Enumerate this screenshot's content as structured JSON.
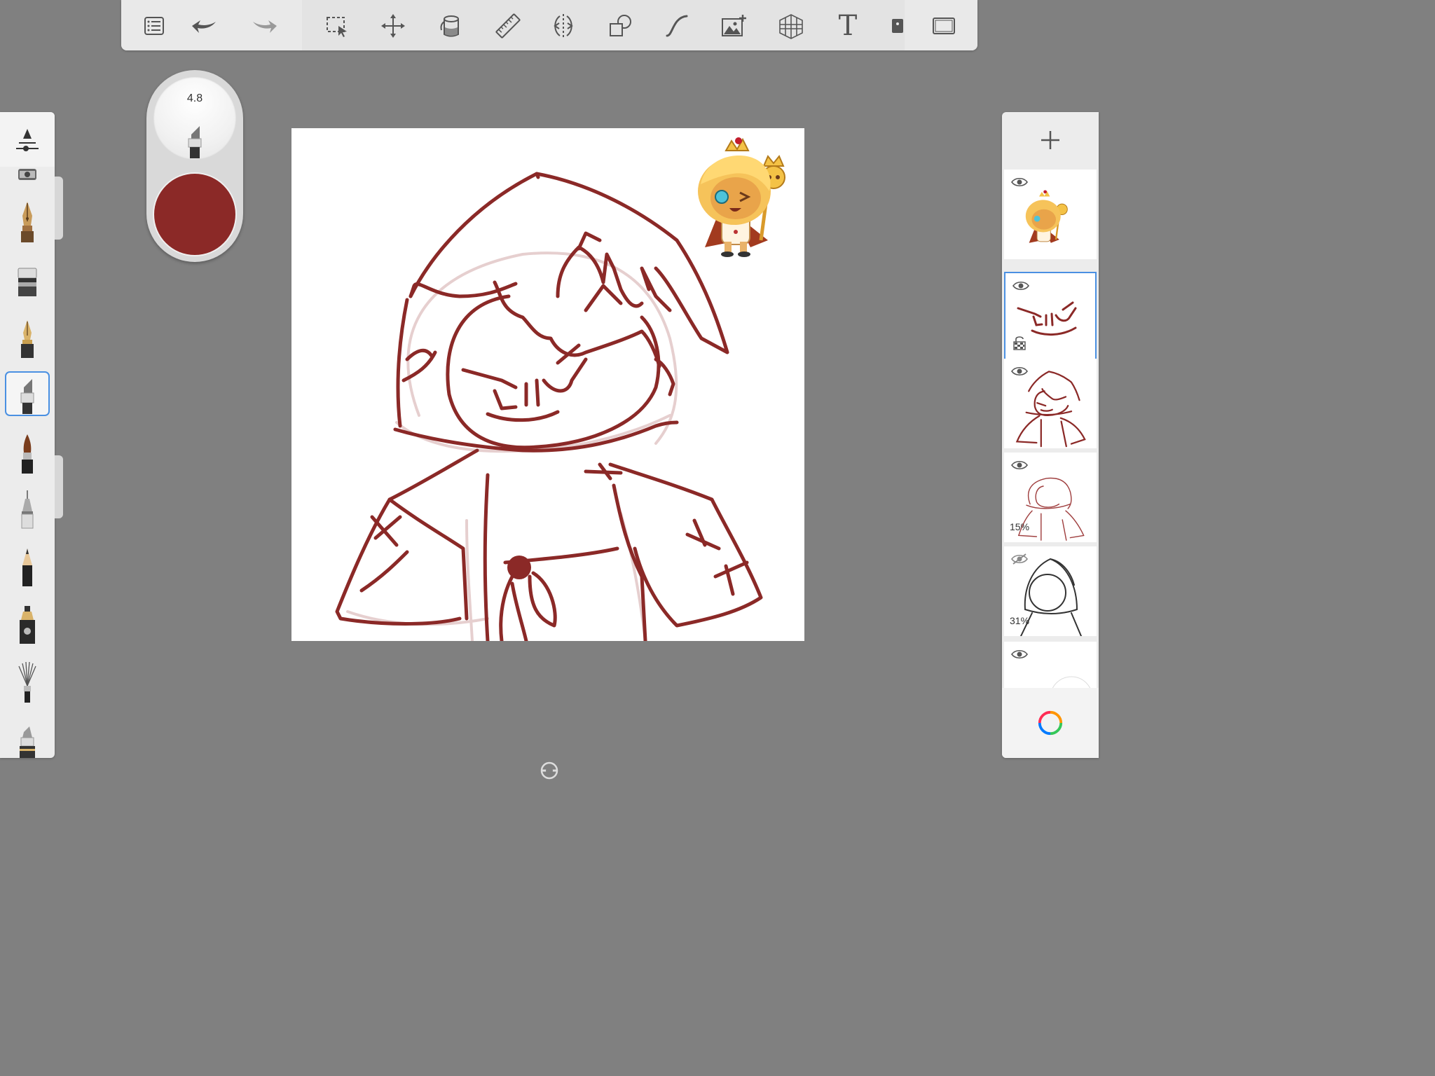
{
  "toolbar": {
    "tools": [
      {
        "name": "menu-list-icon"
      },
      {
        "name": "undo-icon"
      },
      {
        "name": "redo-icon"
      },
      {
        "name": "selection-icon"
      },
      {
        "name": "transform-icon"
      },
      {
        "name": "fill-bucket-icon"
      },
      {
        "name": "ruler-icon"
      },
      {
        "name": "symmetry-icon"
      },
      {
        "name": "shapes-icon"
      },
      {
        "name": "stroke-curve-icon"
      },
      {
        "name": "add-image-icon"
      },
      {
        "name": "perspective-grid-icon"
      },
      {
        "name": "text-tool-icon",
        "glyph": "T"
      },
      {
        "name": "flip-canvas-icon"
      },
      {
        "name": "fullscreen-icon"
      }
    ]
  },
  "brush_panel": {
    "header_icon": "brush-properties-icon",
    "brushes": [
      {
        "name": "airbrush-icon"
      },
      {
        "name": "fountain-pen-icon"
      },
      {
        "name": "eraser-icon"
      },
      {
        "name": "ink-pen-icon"
      },
      {
        "name": "chisel-marker-icon",
        "selected": true
      },
      {
        "name": "paintbrush-icon"
      },
      {
        "name": "technical-pen-icon"
      },
      {
        "name": "pencil-icon"
      },
      {
        "name": "felt-marker-icon"
      },
      {
        "name": "fan-brush-icon"
      },
      {
        "name": "smudge-icon"
      }
    ]
  },
  "brush_puck": {
    "size": "4.8",
    "color": "#8b2927"
  },
  "layers": {
    "add_icon": "plus-icon",
    "items": [
      {
        "name": "reference-layer",
        "visible": true,
        "opacity": ""
      },
      {
        "name": "face-layer",
        "visible": true,
        "opacity": "",
        "selected": true,
        "locked": true
      },
      {
        "name": "lineart-layer",
        "visible": true,
        "opacity": ""
      },
      {
        "name": "sketch-layer",
        "visible": true,
        "opacity": "15%"
      },
      {
        "name": "rough-layer",
        "visible": false,
        "opacity": "31%"
      },
      {
        "name": "background-layer",
        "visible": true,
        "opacity": ""
      }
    ],
    "footer_icon": "color-wheel-icon"
  },
  "colors": {
    "ink": "#8b2927",
    "accent": "#4a90e2",
    "workspace": "#808080"
  }
}
